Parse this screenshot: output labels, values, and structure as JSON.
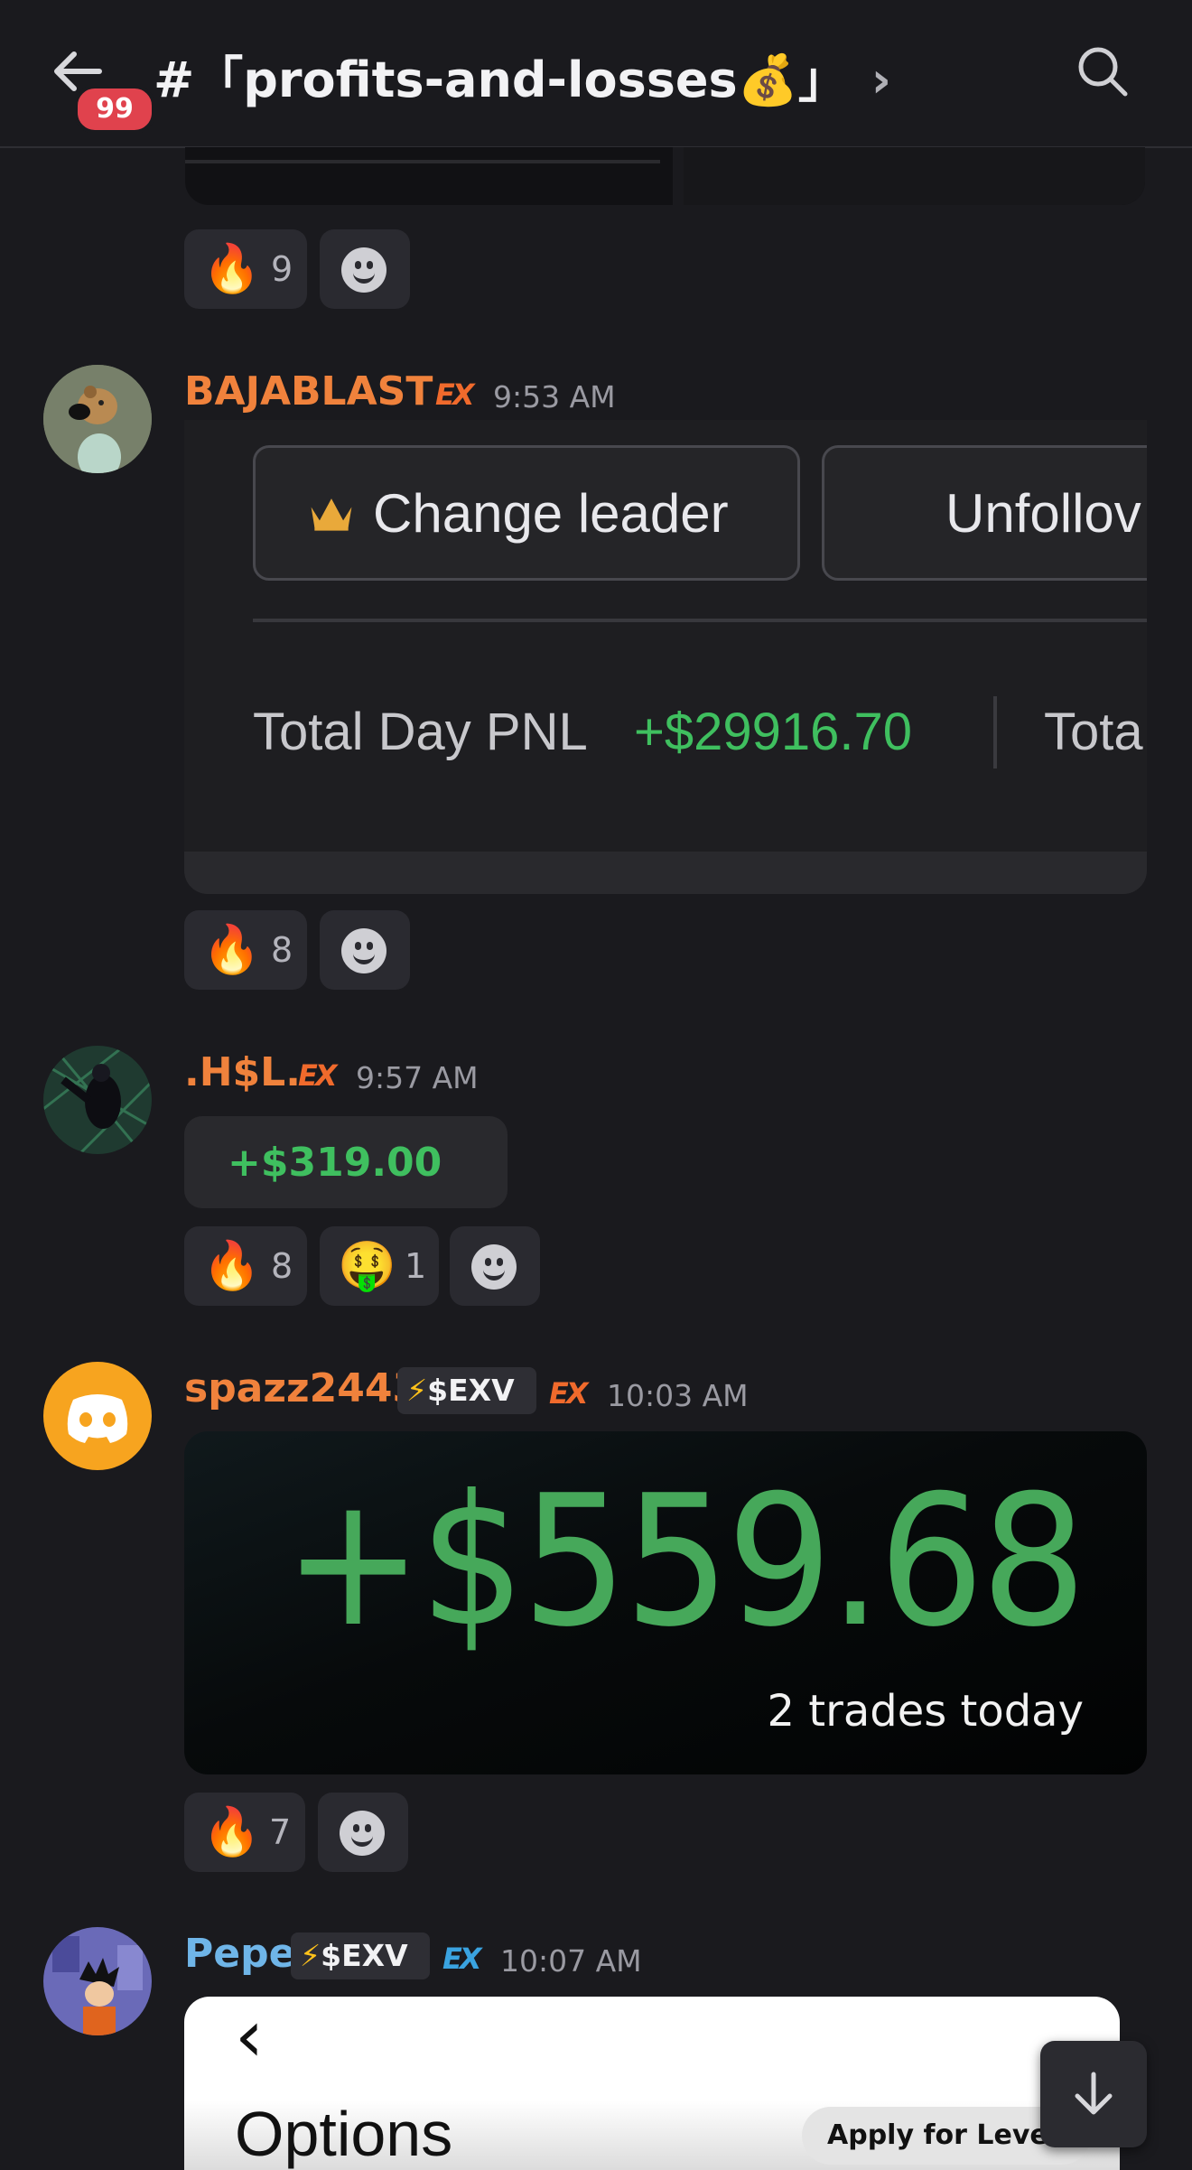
{
  "header": {
    "unread_count": "99",
    "channel_title": "#「profits-and-losses💰」",
    "chevron": "›"
  },
  "top_reactions": [
    {
      "emoji": "🔥",
      "count": "9"
    }
  ],
  "messages": [
    {
      "user": "BAJABLAST",
      "time": "9:53 AM",
      "ex_badge": "EX",
      "card": {
        "button_change_leader": "Change leader",
        "button_unfollow": "Unfollov",
        "pnl_label": "Total Day PNL",
        "pnl_value": "+$29916.70",
        "pnl_more": "Tota"
      },
      "reactions": [
        {
          "emoji": "🔥",
          "count": "8"
        }
      ]
    },
    {
      "user": ".H$L.",
      "time": "9:57 AM",
      "ex_badge": "EX",
      "amount": "+$319.00",
      "reactions": [
        {
          "emoji": "🔥",
          "count": "8"
        },
        {
          "emoji": "🤑",
          "count": "1"
        }
      ]
    },
    {
      "user": "spazz2443",
      "tag": "$EXV",
      "time": "10:03 AM",
      "ex_badge": "EX",
      "image": {
        "amount": "+$559.68",
        "subtitle": "2 trades today"
      },
      "reactions": [
        {
          "emoji": "🔥",
          "count": "7"
        }
      ]
    },
    {
      "user": "Pepe",
      "tag": "$EXV",
      "time": "10:07 AM",
      "ex_badge": "EX",
      "image": {
        "back": "‹",
        "title": "Options",
        "apply": "Apply for Level 3"
      }
    }
  ],
  "colors": {
    "background": "#1a1a1e",
    "username_orange": "#f0823c",
    "username_blue": "#6fb5e8",
    "green": "#3fbf5f",
    "badge_red": "#e0424d"
  },
  "icons": [
    "back-arrow-icon",
    "search-icon",
    "add-reaction-icon",
    "scroll-down-icon",
    "discord-logo-icon",
    "crown-icon"
  ]
}
